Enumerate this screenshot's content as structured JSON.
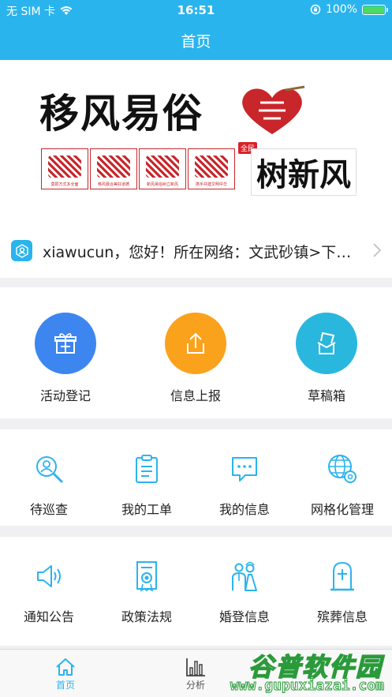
{
  "status_bar": {
    "carrier": "无 SIM 卡",
    "time": "16:51",
    "battery": "100%"
  },
  "nav": {
    "title": "首页"
  },
  "banner": {
    "title": "移风易俗",
    "subtitle": "树新风",
    "tag": "全民",
    "papercut_captions": [
      "莫把方式多全面",
      "移风融合美好道德",
      "新风易俗树立新风",
      "携手共建文明中华"
    ]
  },
  "notice": {
    "text": "xiawucun，您好！所在网络：文武砂镇>下…"
  },
  "primary_actions": [
    {
      "label": "活动登记",
      "icon": "gift-icon",
      "color": "#3d86f0"
    },
    {
      "label": "信息上报",
      "icon": "upload-icon",
      "color": "#fba21c"
    },
    {
      "label": "草稿箱",
      "icon": "draft-box-icon",
      "color": "#29b7de"
    }
  ],
  "grid_row1": [
    {
      "label": "待巡查",
      "icon": "patrol-search-icon"
    },
    {
      "label": "我的工单",
      "icon": "clipboard-icon"
    },
    {
      "label": "我的信息",
      "icon": "message-icon"
    },
    {
      "label": "网格化管理",
      "icon": "globe-gear-icon"
    }
  ],
  "grid_row2": [
    {
      "label": "通知公告",
      "icon": "speaker-icon"
    },
    {
      "label": "政策法规",
      "icon": "certificate-icon"
    },
    {
      "label": "婚登信息",
      "icon": "wedding-couple-icon"
    },
    {
      "label": "殡葬信息",
      "icon": "tombstone-icon"
    }
  ],
  "tabbar": [
    {
      "label": "首页",
      "icon": "home-icon",
      "active": true
    },
    {
      "label": "分析",
      "icon": "bar-chart-icon",
      "active": false
    }
  ],
  "watermark": {
    "title": "谷普软件园",
    "url": "www.gupuxiazai.com"
  },
  "colors": {
    "primary": "#2ab4ed",
    "blue_button": "#3d86f0",
    "orange_button": "#fba21c",
    "teal_button": "#29b7de",
    "background": "#f0f0f3"
  }
}
